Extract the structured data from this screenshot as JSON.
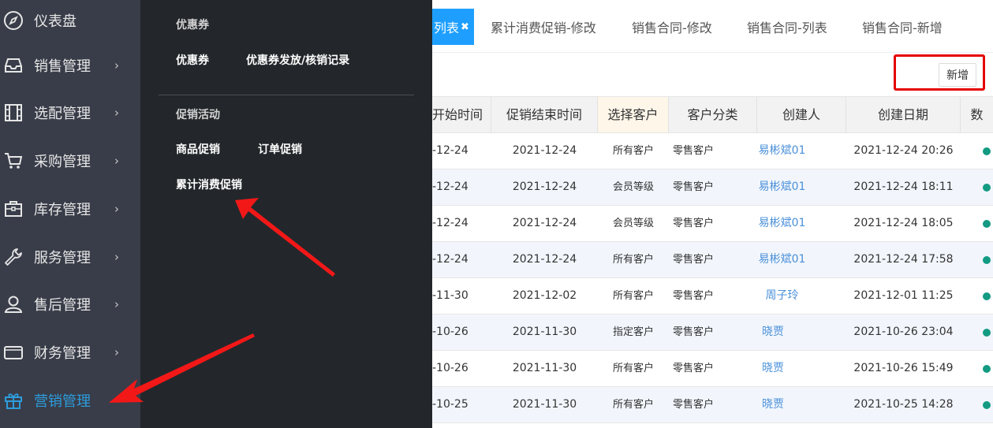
{
  "sidebar": {
    "items": [
      {
        "label": "仪表盘",
        "icon": "compass-icon",
        "has_chevron": false
      },
      {
        "label": "销售管理",
        "icon": "inbox-icon",
        "has_chevron": true
      },
      {
        "label": "选配管理",
        "icon": "film-icon",
        "has_chevron": true
      },
      {
        "label": "采购管理",
        "icon": "cart-icon",
        "has_chevron": true
      },
      {
        "label": "库存管理",
        "icon": "briefcase-icon",
        "has_chevron": true
      },
      {
        "label": "服务管理",
        "icon": "wrench-icon",
        "has_chevron": true
      },
      {
        "label": "售后管理",
        "icon": "user-icon",
        "has_chevron": true
      },
      {
        "label": "财务管理",
        "icon": "card-icon",
        "has_chevron": true
      },
      {
        "label": "营销管理",
        "icon": "gift-icon",
        "has_chevron": false,
        "active": true
      }
    ],
    "chevron": "›"
  },
  "flyout": {
    "section1_title": "优惠券",
    "section1_links": [
      "优惠券",
      "优惠券发放/核销记录"
    ],
    "section2_title": "促销活动",
    "section2_links": [
      "商品促销",
      "订单促销",
      "累计消费促销"
    ]
  },
  "tabs": {
    "active_label": "列表",
    "close_icon": "✖",
    "others": [
      "累计消费促销-修改",
      "销售合同-修改",
      "销售合同-列表",
      "销售合同-新增"
    ]
  },
  "toolbar": {
    "add_label": "新增"
  },
  "table": {
    "headers": [
      "开始时间",
      "促销结束时间",
      "选择客户",
      "客户分类",
      "创建人",
      "创建日期",
      "数"
    ],
    "rows": [
      {
        "start": "-12-24",
        "end": "2021-12-24",
        "customer": "所有客户",
        "category": "零售客户",
        "creator": "易彬斌01",
        "created": "2021-12-24 20:26"
      },
      {
        "start": "-12-24",
        "end": "2021-12-24",
        "customer": "会员等级",
        "category": "零售客户",
        "creator": "易彬斌01",
        "created": "2021-12-24 18:11"
      },
      {
        "start": "-12-24",
        "end": "2021-12-24",
        "customer": "会员等级",
        "category": "零售客户",
        "creator": "易彬斌01",
        "created": "2021-12-24 18:05"
      },
      {
        "start": "-12-24",
        "end": "2021-12-24",
        "customer": "所有客户",
        "category": "零售客户",
        "creator": "易彬斌01",
        "created": "2021-12-24 17:58"
      },
      {
        "start": "-11-30",
        "end": "2021-12-02",
        "customer": "所有客户",
        "category": "零售客户",
        "creator": "周子玲",
        "created": "2021-12-01 11:25"
      },
      {
        "start": "-10-26",
        "end": "2021-11-30",
        "customer": "指定客户",
        "category": "零售客户",
        "creator": "晓贾",
        "created": "2021-10-26 23:04"
      },
      {
        "start": "-10-26",
        "end": "2021-11-30",
        "customer": "所有客户",
        "category": "零售客户",
        "creator": "晓贾",
        "created": "2021-10-26 15:49"
      },
      {
        "start": "-10-25",
        "end": "2021-11-30",
        "customer": "所有客户",
        "category": "零售客户",
        "creator": "晓贾",
        "created": "2021-10-25 14:28"
      }
    ],
    "status_color": "#139a82"
  },
  "colors": {
    "sidebar_bg": "#393d49",
    "flyout_bg": "#23272b",
    "accent": "#1e9fff",
    "annotation_red": "#e60000"
  }
}
